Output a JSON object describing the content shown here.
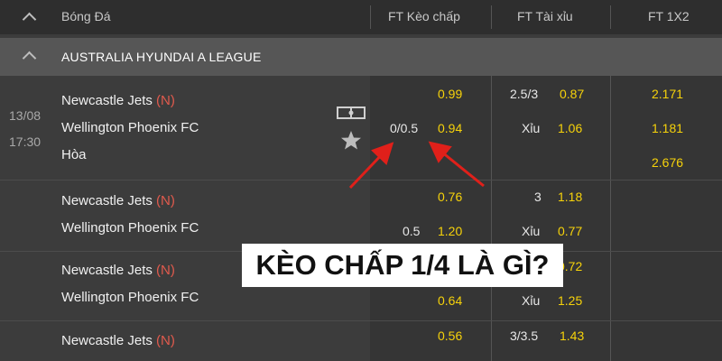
{
  "header": {
    "sport": "Bóng Đá",
    "col_handicap": "FT Kèo chấp",
    "col_overunder": "FT Tài xỉu",
    "col_1x2": "FT 1X2"
  },
  "league": {
    "name": "AUSTRALIA HYUNDAI A LEAGUE"
  },
  "match1": {
    "date": "13/08",
    "time": "17:30",
    "home": "Newcastle Jets",
    "home_flag": "(N)",
    "away": "Wellington Phoenix FC",
    "draw": "Hòa",
    "handicap_line": "0/0.5",
    "handicap_home": "0.99",
    "handicap_away": "0.94",
    "ou_line": "2.5/3",
    "ou_over": "0.87",
    "ou_under_label": "Xỉu",
    "ou_under": "1.06",
    "x_home": "2.171",
    "x_away": "1.181",
    "x_draw": "2.676"
  },
  "match2": {
    "home": "Newcastle Jets",
    "home_flag": "(N)",
    "away": "Wellington Phoenix FC",
    "handicap_line": "0.5",
    "handicap_home": "0.76",
    "handicap_away": "1.20",
    "ou_line": "3",
    "ou_over": "1.18",
    "ou_under_label": "Xỉu",
    "ou_under": "0.77"
  },
  "match3": {
    "home": "Newcastle Jets",
    "home_flag": "(N)",
    "away": "Wellington Phoenix FC",
    "handicap_away": "0.64",
    "ou_over": "0.72",
    "ou_under_label": "Xỉu",
    "ou_under": "1.25"
  },
  "match4": {
    "home": "Newcastle Jets",
    "home_flag": "(N)",
    "handicap_home": "0.56",
    "ou_line": "3/3.5",
    "ou_over": "1.43"
  },
  "overlay": {
    "text": "KÈO CHẤP 1/4 LÀ GÌ?"
  },
  "colors": {
    "odds": "#f6d20a",
    "flag": "#e05a4d",
    "arrow": "#e0201a"
  }
}
